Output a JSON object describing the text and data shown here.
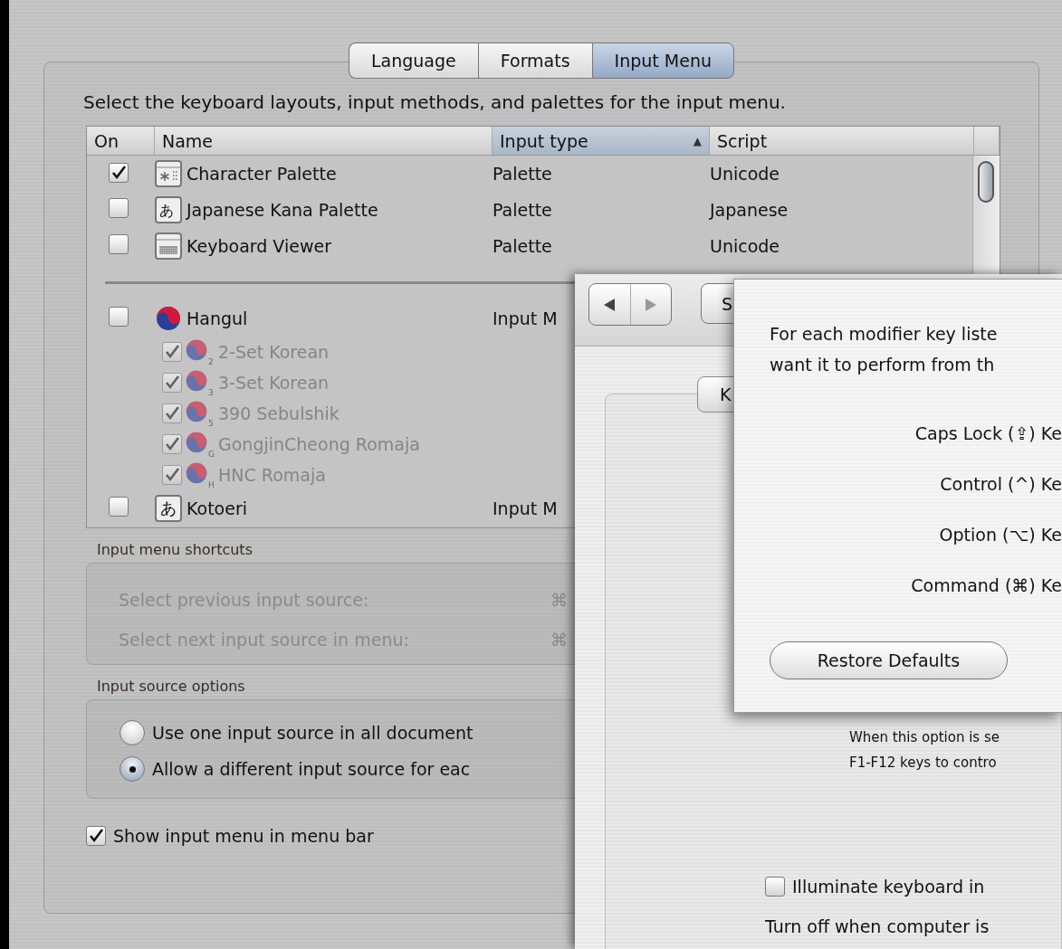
{
  "preferences_window": {
    "tabs": [
      {
        "label": "Language",
        "selected": false
      },
      {
        "label": "Formats",
        "selected": false
      },
      {
        "label": "Input Menu",
        "selected": true
      }
    ],
    "instruction": "Select the keyboard layouts, input methods, and palettes for the input menu.",
    "table": {
      "columns": [
        {
          "label": "On",
          "selected": false
        },
        {
          "label": "Name",
          "selected": false
        },
        {
          "label": "Input type",
          "selected": true,
          "sort_indicator": "▲"
        },
        {
          "label": "Script",
          "selected": false
        }
      ],
      "rows": [
        {
          "kind": "item",
          "checked": true,
          "name": "Character Palette",
          "type": "Palette",
          "script": "Unicode"
        },
        {
          "kind": "item",
          "checked": false,
          "glyph": "あ",
          "name": "Japanese Kana Palette",
          "type": "Palette",
          "script": "Japanese"
        },
        {
          "kind": "item",
          "checked": false,
          "name": "Keyboard Viewer",
          "type": "Palette",
          "script": "Unicode"
        },
        {
          "kind": "separator"
        },
        {
          "kind": "item",
          "checked": false,
          "name": "Hangul",
          "type": "Input M",
          "children": [
            {
              "checked": true,
              "disabled": true,
              "icon_label": "2",
              "name": "2-Set Korean"
            },
            {
              "checked": true,
              "disabled": true,
              "icon_label": "3",
              "name": "3-Set Korean"
            },
            {
              "checked": true,
              "disabled": true,
              "icon_label": "5",
              "name": "390 Sebulshik"
            },
            {
              "checked": true,
              "disabled": true,
              "icon_label": "G",
              "name": "GongjinCheong Romaja"
            },
            {
              "checked": true,
              "disabled": true,
              "icon_label": "H",
              "name": "HNC Romaja"
            }
          ]
        },
        {
          "kind": "item",
          "checked": false,
          "glyph": "あ",
          "name": "Kotoeri",
          "type": "Input M"
        }
      ]
    },
    "shortcuts": {
      "title": "Input menu shortcuts",
      "disabled": true,
      "items": [
        {
          "label": "Select previous input source:",
          "shortcut": "⌘"
        },
        {
          "label": "Select next input source in menu:",
          "shortcut": "⌘"
        }
      ]
    },
    "source_options": {
      "title": "Input source options",
      "options": [
        {
          "label": "Use one input source in all document",
          "selected": false
        },
        {
          "label": "Allow a different input source for eac",
          "selected": true
        }
      ]
    },
    "show_menu_checkbox": {
      "label": "Show input menu in menu bar",
      "checked": true
    }
  },
  "keyboard_window": {
    "show_all_button": "S",
    "tab": "K",
    "option_description": [
      "When this option is se",
      "F1-F12 keys to contro"
    ],
    "illuminate_checkbox": {
      "label": "Illuminate keyboard in",
      "checked": false
    },
    "turn_off_text": "Turn off when computer is"
  },
  "modifier_sheet": {
    "message_lines": [
      "For each modifier key liste",
      "want it to perform from th"
    ],
    "keys": [
      "Caps Lock (⇪) Ke",
      "Control (^) Ke",
      "Option (⌥) Ke",
      "Command (⌘) Ke"
    ],
    "restore_button": "Restore Defaults"
  }
}
